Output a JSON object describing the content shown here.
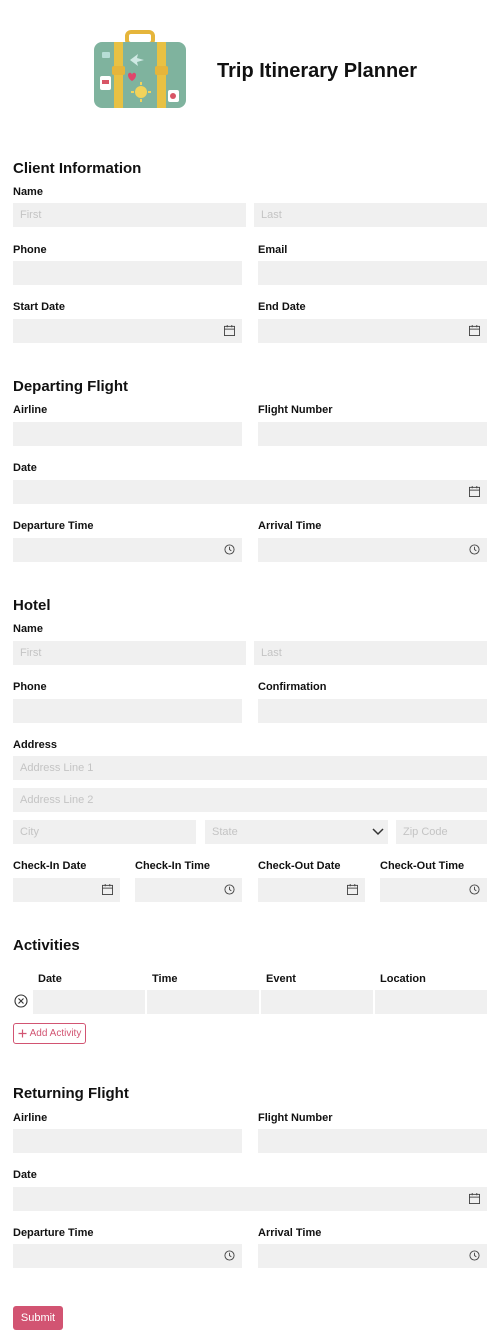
{
  "title": "Trip Itinerary Planner",
  "accent_color": "#d25472",
  "field_bg": "#f0f0f0",
  "client": {
    "heading": "Client Information",
    "name_label": "Name",
    "first_ph": "First",
    "last_ph": "Last",
    "phone_label": "Phone",
    "email_label": "Email",
    "start_label": "Start Date",
    "end_label": "End Date"
  },
  "departing": {
    "heading": "Departing Flight",
    "airline_label": "Airline",
    "flight_label": "Flight Number",
    "date_label": "Date",
    "dep_time_label": "Departure Time",
    "arr_time_label": "Arrival Time"
  },
  "hotel": {
    "heading": "Hotel",
    "name_label": "Name",
    "first_ph": "First",
    "last_ph": "Last",
    "phone_label": "Phone",
    "confirmation_label": "Confirmation",
    "address_label": "Address",
    "addr1_ph": "Address Line 1",
    "addr2_ph": "Address Line 2",
    "city_ph": "City",
    "state_ph": "State",
    "zip_ph": "Zip Code",
    "checkin_date_label": "Check-In Date",
    "checkin_time_label": "Check-In Time",
    "checkout_date_label": "Check-Out Date",
    "checkout_time_label": "Check-Out Time"
  },
  "activities": {
    "heading": "Activities",
    "columns": [
      "Date",
      "Time",
      "Event",
      "Location"
    ],
    "add_label": "Add Activity"
  },
  "returning": {
    "heading": "Returning Flight",
    "airline_label": "Airline",
    "flight_label": "Flight Number",
    "date_label": "Date",
    "dep_time_label": "Departure Time",
    "arr_time_label": "Arrival Time"
  },
  "submit_label": "Submit",
  "icons": [
    "suitcase-icon",
    "calendar-icon",
    "clock-icon",
    "chevron-down-icon",
    "remove-row-icon",
    "plus-icon"
  ]
}
